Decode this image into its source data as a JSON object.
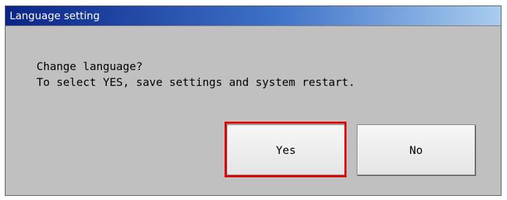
{
  "dialog": {
    "title": "Language setting",
    "message_line1": "Change language?",
    "message_line2": "To select YES, save settings and system restart.",
    "buttons": {
      "yes_label": "Yes",
      "no_label": "No"
    }
  },
  "colors": {
    "dialog_background": "#c0c0c0",
    "titlebar_start": "#0a2488",
    "titlebar_end": "#a9cdef",
    "highlight": "#e00000"
  }
}
